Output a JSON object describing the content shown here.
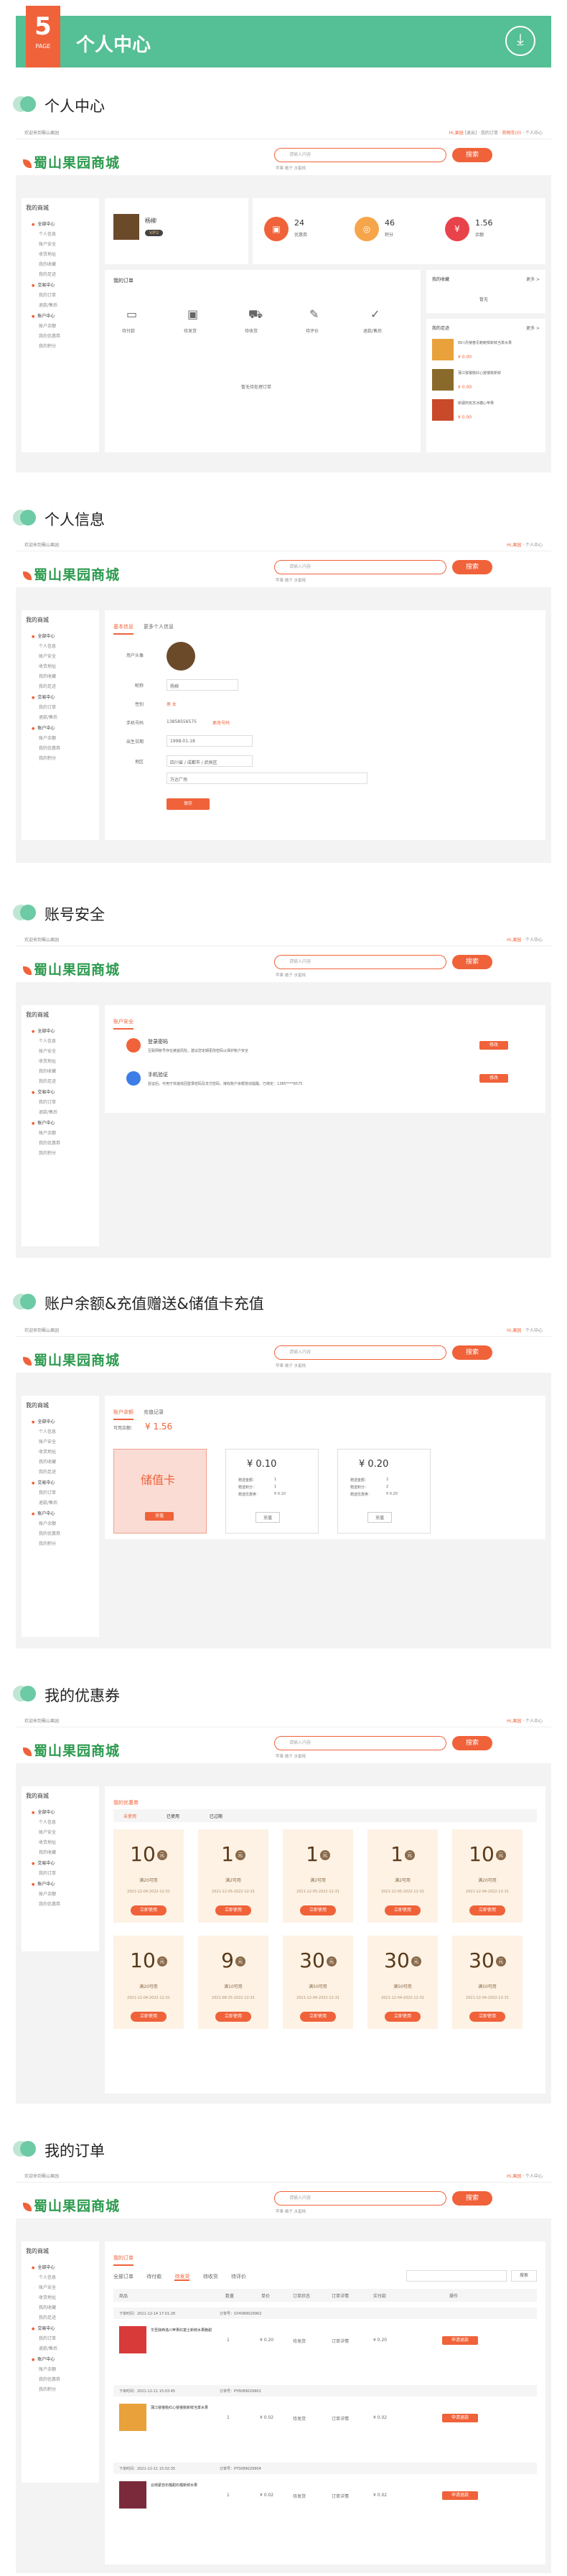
{
  "header": {
    "number": "5",
    "part": "PAGE",
    "title": "个人中心",
    "download_icon": "download-icon"
  },
  "sections": [
    "个人中心",
    "个人信息",
    "账号安全",
    "账户余额&充值赠送&储值卡充值",
    "我的优惠券",
    "我的订单"
  ],
  "site": {
    "welcome": "欢迎来到蜀山果园",
    "top_links": [
      "Hi,果园",
      "[退出]",
      "我的订单",
      "购物车(0)",
      "个人中心"
    ],
    "logo": "蜀山果园商城",
    "search_placeholder": "请输入内容",
    "search_button": "搜索",
    "hot": "苹果 橘子 水蜜桃"
  },
  "sidebar": {
    "title": "我的商城",
    "groups": [
      {
        "label": "全部中心",
        "items": [
          "个人信息",
          "账户安全",
          "收货地址",
          "我的收藏",
          "我的足迹"
        ]
      },
      {
        "label": "交易中心",
        "items": [
          "我的订单",
          "退款/售后"
        ]
      },
      {
        "label": "账户中心",
        "items": [
          "账户余额",
          "我的优惠券",
          "我的积分"
        ]
      }
    ]
  },
  "center": {
    "username": "杨柳",
    "vip": "VIP2",
    "stats": [
      {
        "value": "24",
        "label": "优惠券"
      },
      {
        "value": "46",
        "label": "积分"
      },
      {
        "value": "1.56",
        "label": "余额"
      }
    ],
    "orders_title": "我的订单",
    "order_items": [
      "待付款",
      "待发货",
      "待收货",
      "待评价",
      "退款/售后"
    ],
    "no_orders": "暂无待处理订单",
    "fav_title": "我的收藏",
    "more": "更多 >",
    "fav_empty": "暂无",
    "foot_title": "我的足迹",
    "foot_items": [
      {
        "name": "四川丹棱春见耙耙柑新鲜当季水果",
        "price": "¥ 0.00"
      },
      {
        "name": "蒲江猕猴桃红心猕猴桃新鲜",
        "price": "¥ 0.00"
      },
      {
        "name": "新疆阿克苏冰糖心苹果",
        "price": "¥ 0.00"
      }
    ]
  },
  "info": {
    "tabs": [
      "基本信息",
      "更多个人信息"
    ],
    "fields": [
      {
        "label": "用户头像",
        "value": ""
      },
      {
        "label": "昵称",
        "value": "杨柳"
      },
      {
        "label": "性别",
        "value": "男   女"
      },
      {
        "label": "手机号码",
        "value": "13858556575",
        "extra": "更改号码"
      },
      {
        "label": "出生日期",
        "value": "1998-01-18"
      },
      {
        "label": "地区",
        "value": "四川省 / 成都市 / 武侯区"
      },
      {
        "label": "",
        "value": "万达广场"
      }
    ],
    "save": "保存"
  },
  "security": {
    "tab": "账户安全",
    "items": [
      {
        "title": "登录密码",
        "desc": "互联网帐号存在被盗风险，建议您定期更改密码以保护账户安全",
        "btn": "修改"
      },
      {
        "title": "手机验证",
        "desc": "验证后，可用于快速找回登录密码及支付密码，接收账户余额变动提醒。已绑定：1385****6575",
        "btn": "修改"
      }
    ]
  },
  "balance": {
    "tabs": [
      "账户余额",
      "充值记录"
    ],
    "label": "可用余额：",
    "amount": "¥ 1.56",
    "stored": "储值卡",
    "stored_btn": "充值",
    "cards": [
      {
        "amount": "¥ 0.10",
        "l1": "赠送金额：",
        "v1": "1",
        "l2": "赠送积分：",
        "v2": "1",
        "l3": "赠送优惠券：",
        "v3": "¥ 0.10",
        "btn": "充值"
      },
      {
        "amount": "¥ 0.20",
        "l1": "赠送金额：",
        "v1": "2",
        "l2": "赠送积分：",
        "v2": "2",
        "l3": "赠送优惠券：",
        "v3": "¥ 0.20",
        "btn": "充值"
      }
    ]
  },
  "coupons": {
    "title": "我的优惠券",
    "tabs": [
      "未使用",
      "已使用",
      "已过期"
    ],
    "items": [
      {
        "v": "10",
        "cond": "满20可用",
        "date": "2021-12-04-2022-12-31",
        "btn": "立即使用"
      },
      {
        "v": "1",
        "cond": "满2可用",
        "date": "2021-12-05-2022-12-31",
        "btn": "立即使用"
      },
      {
        "v": "1",
        "cond": "满2可用",
        "date": "2021-12-05-2022-12-31",
        "btn": "立即使用"
      },
      {
        "v": "1",
        "cond": "满2可用",
        "date": "2021-12-05-2022-12-31",
        "btn": "立即使用"
      },
      {
        "v": "10",
        "cond": "满20可用",
        "date": "2021-12-04-2022-12-31",
        "btn": "立即使用"
      },
      {
        "v": "10",
        "cond": "满20可用",
        "date": "2021-12-04-2022-12-31",
        "btn": "立即使用"
      },
      {
        "v": "9",
        "cond": "满10可用",
        "date": "2021-08-25-2022-12-31",
        "btn": "立即使用"
      },
      {
        "v": "30",
        "cond": "满50可用",
        "date": "2021-12-04-2022-12-31",
        "btn": "立即使用"
      },
      {
        "v": "30",
        "cond": "满50可用",
        "date": "2021-12-04-2022-12-31",
        "btn": "立即使用"
      },
      {
        "v": "30",
        "cond": "满50可用",
        "date": "2021-12-04-2022-12-31",
        "btn": "立即使用"
      }
    ],
    "unit": "元"
  },
  "orders": {
    "title": "我的订单",
    "tabs": [
      "全部订单",
      "待付款",
      "待发货",
      "待收货",
      "待评价"
    ],
    "search_btn": "搜索",
    "columns": [
      "商品",
      "数量",
      "单价",
      "订单状态",
      "订单详情",
      "实付款",
      "操作"
    ],
    "rows": [
      {
        "time": "下单时间：2021-12-14 17:01:28",
        "no": "订单号：GY4089029902",
        "name": "华圣陕西洛川苹果红富士新鲜水果脆甜",
        "qty": "1",
        "price": "¥ 0.20",
        "status": "待发货",
        "detail": "订单详情",
        "pay": "¥ 0.20",
        "op": "申请退款"
      },
      {
        "time": "下单时间：2021-12-11 15:03:45",
        "no": "订单号：PY6089029902",
        "name": "蒲江猕猴桃红心猕猴桃新鲜当季水果",
        "qty": "1",
        "price": "¥ 0.02",
        "status": "待发货",
        "detail": "订单详情",
        "pay": "¥ 0.02",
        "op": "申请退款"
      },
      {
        "time": "下单时间：2021-12-11 15:02:35",
        "no": "订单号：PY5089029904",
        "name": "云南蒙自石榴甜石榴新鲜水果",
        "qty": "1",
        "price": "¥ 0.02",
        "status": "待发货",
        "detail": "订单详情",
        "pay": "¥ 0.02",
        "op": "申请退款"
      }
    ]
  }
}
